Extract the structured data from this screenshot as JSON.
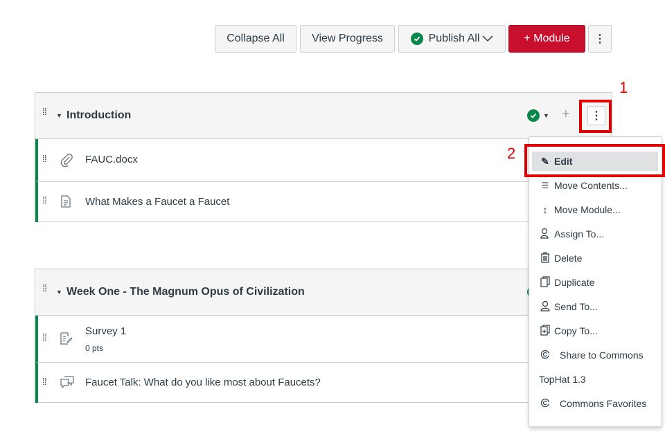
{
  "toolbar": {
    "collapse_all": "Collapse All",
    "view_progress": "View Progress",
    "publish_all": "Publish All",
    "add_module": "+ Module"
  },
  "modules": [
    {
      "title": "Introduction",
      "items": [
        {
          "label": "FAUC.docx",
          "icon": "paperclip-icon"
        },
        {
          "label": "What Makes a Faucet a Faucet",
          "icon": "page-icon"
        }
      ]
    },
    {
      "title": "Week One - The Magnum Opus of Civilization",
      "items": [
        {
          "label": "Survey 1",
          "sub": "0 pts",
          "icon": "survey-icon"
        },
        {
          "label": "Faucet Talk: What do you like most about Faucets?",
          "icon": "discussion-icon"
        }
      ]
    }
  ],
  "menu": {
    "items": [
      {
        "label": "Edit",
        "icon": "pencil-icon"
      },
      {
        "label": "Move Contents...",
        "icon": "move-contents-icon"
      },
      {
        "label": "Move Module...",
        "icon": "move-vertical-icon"
      },
      {
        "label": "Assign To...",
        "icon": "assign-user-icon"
      },
      {
        "label": "Delete",
        "icon": "trash-icon"
      },
      {
        "label": "Duplicate",
        "icon": "duplicate-icon"
      },
      {
        "label": "Send To...",
        "icon": "send-user-icon"
      },
      {
        "label": "Copy To...",
        "icon": "copy-to-icon"
      },
      {
        "label": "Share to Commons",
        "icon": "commons-icon"
      },
      {
        "label": "TopHat 1.3"
      },
      {
        "label": "Commons Favorites",
        "icon": "commons-icon"
      }
    ]
  },
  "annotations": {
    "step1": "1",
    "step2": "2",
    "color": "#e00000"
  },
  "colors": {
    "brand_red": "#c8102e",
    "published_green": "#0b874b"
  }
}
